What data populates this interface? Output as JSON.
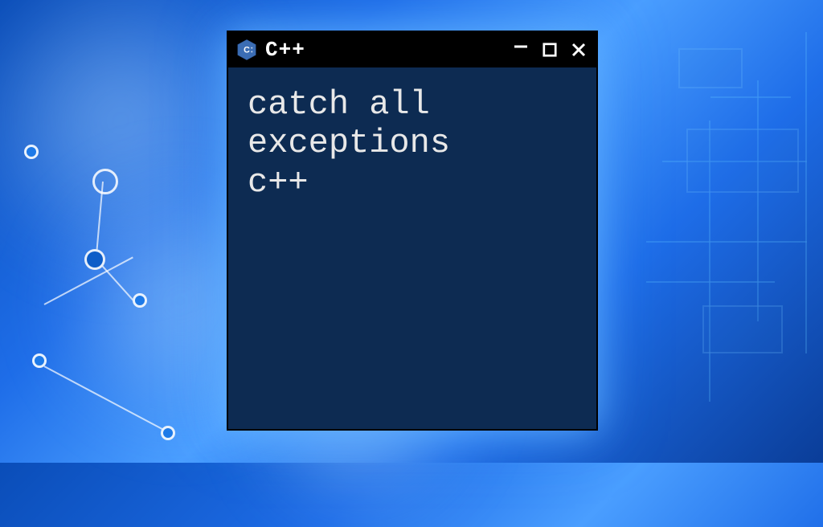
{
  "window": {
    "title": "C++",
    "icon_label": "C++",
    "body_text": "catch all\nexceptions\nc++"
  },
  "colors": {
    "window_bg": "#0d2b52",
    "titlebar_bg": "#000000",
    "text": "#e8e8e8",
    "accent": "#1e7ae8"
  }
}
